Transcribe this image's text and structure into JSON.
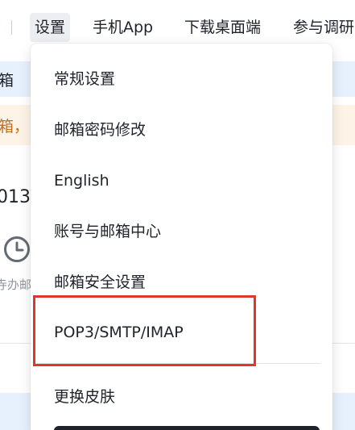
{
  "topnav": {
    "items": [
      {
        "label": "设置",
        "active": true
      },
      {
        "label": "手机App",
        "active": false
      },
      {
        "label": "下载桌面端",
        "active": false
      },
      {
        "label": "参与调研",
        "active": false
      }
    ]
  },
  "background": {
    "tab_fragment": "箱",
    "notice_fragment": "箱，",
    "date_fragment": "013,",
    "todo_fragment": "寺办邮"
  },
  "settings_menu": {
    "items": [
      "常规设置",
      "邮箱密码修改",
      "English",
      "账号与邮箱中心",
      "邮箱安全设置",
      "POP3/SMTP/IMAP",
      "更换皮肤"
    ],
    "highlighted_item": "POP3/SMTP/IMAP",
    "highlight_color": "#e0362b"
  },
  "colors": {
    "text_primary": "#1f2329",
    "active_nav_bg": "#eceef1",
    "blue_row_bg": "#e7f0fd",
    "notice_bg": "#fdf3e6",
    "notice_text": "#c0711c"
  }
}
